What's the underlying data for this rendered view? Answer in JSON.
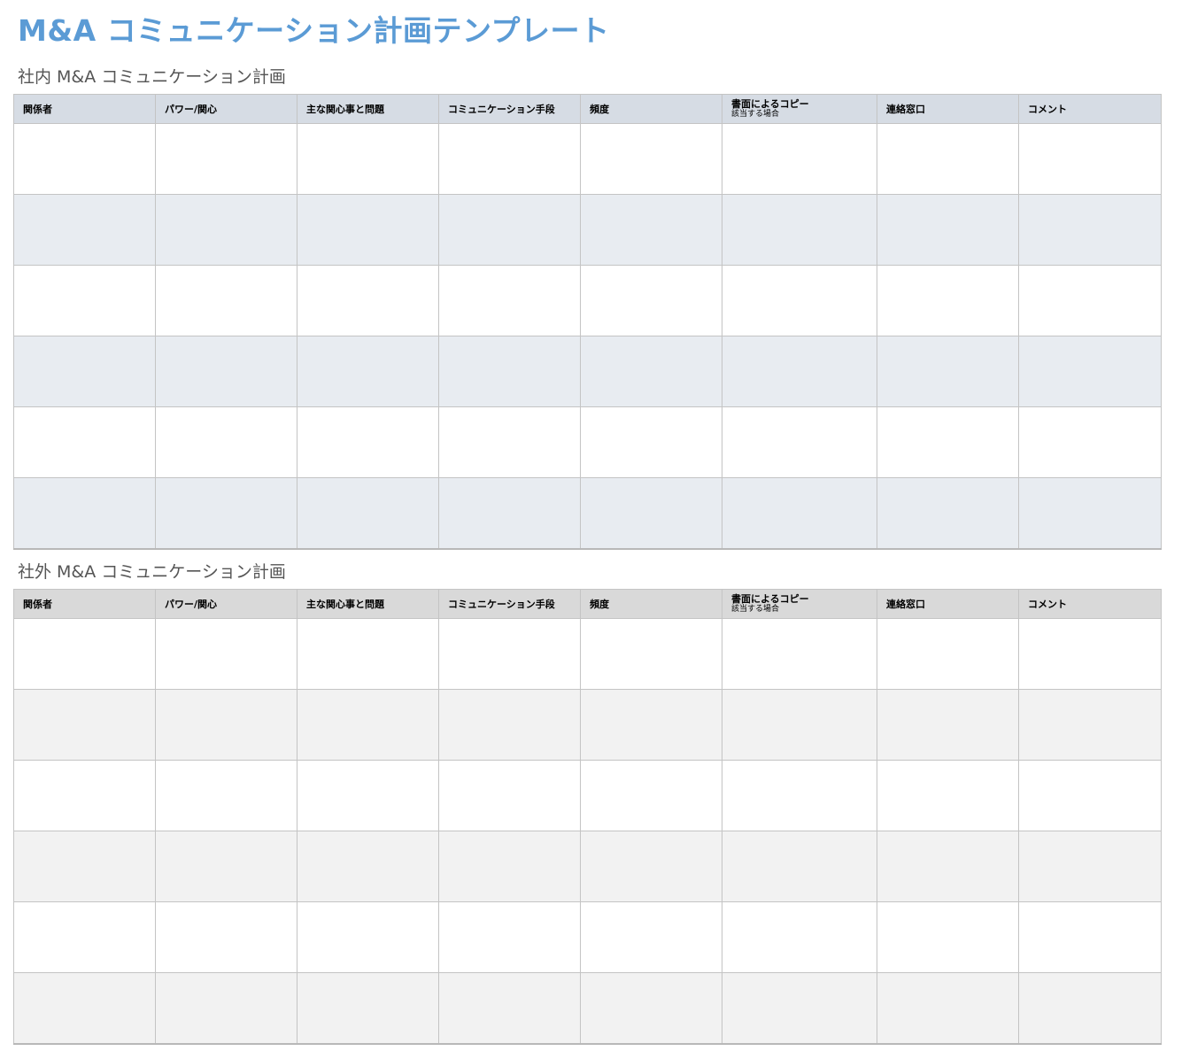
{
  "page": {
    "title": "M&A コミュニケーション計画テンプレート"
  },
  "internal": {
    "title": "社内 M&A コミュニケーション計画",
    "columns": [
      {
        "label": "関係者",
        "sub": ""
      },
      {
        "label": "パワー/関心",
        "sub": ""
      },
      {
        "label": "主な関心事と問題",
        "sub": ""
      },
      {
        "label": "コミュニケーション手段",
        "sub": ""
      },
      {
        "label": "頻度",
        "sub": ""
      },
      {
        "label": "書面によるコピー",
        "sub": "該当する場合"
      },
      {
        "label": "連絡窓口",
        "sub": ""
      },
      {
        "label": "コメント",
        "sub": ""
      }
    ],
    "rows": [
      [
        "",
        "",
        "",
        "",
        "",
        "",
        "",
        ""
      ],
      [
        "",
        "",
        "",
        "",
        "",
        "",
        "",
        ""
      ],
      [
        "",
        "",
        "",
        "",
        "",
        "",
        "",
        ""
      ],
      [
        "",
        "",
        "",
        "",
        "",
        "",
        "",
        ""
      ],
      [
        "",
        "",
        "",
        "",
        "",
        "",
        "",
        ""
      ],
      [
        "",
        "",
        "",
        "",
        "",
        "",
        "",
        ""
      ]
    ]
  },
  "external": {
    "title": "社外 M&A コミュニケーション計画",
    "columns": [
      {
        "label": "関係者",
        "sub": ""
      },
      {
        "label": "パワー/関心",
        "sub": ""
      },
      {
        "label": "主な関心事と問題",
        "sub": ""
      },
      {
        "label": "コミュニケーション手段",
        "sub": ""
      },
      {
        "label": "頻度",
        "sub": ""
      },
      {
        "label": "書面によるコピー",
        "sub": "該当する場合"
      },
      {
        "label": "連絡窓口",
        "sub": ""
      },
      {
        "label": "コメント",
        "sub": ""
      }
    ],
    "rows": [
      [
        "",
        "",
        "",
        "",
        "",
        "",
        "",
        ""
      ],
      [
        "",
        "",
        "",
        "",
        "",
        "",
        "",
        ""
      ],
      [
        "",
        "",
        "",
        "",
        "",
        "",
        "",
        ""
      ],
      [
        "",
        "",
        "",
        "",
        "",
        "",
        "",
        ""
      ],
      [
        "",
        "",
        "",
        "",
        "",
        "",
        "",
        ""
      ],
      [
        "",
        "",
        "",
        "",
        "",
        "",
        "",
        ""
      ]
    ]
  }
}
